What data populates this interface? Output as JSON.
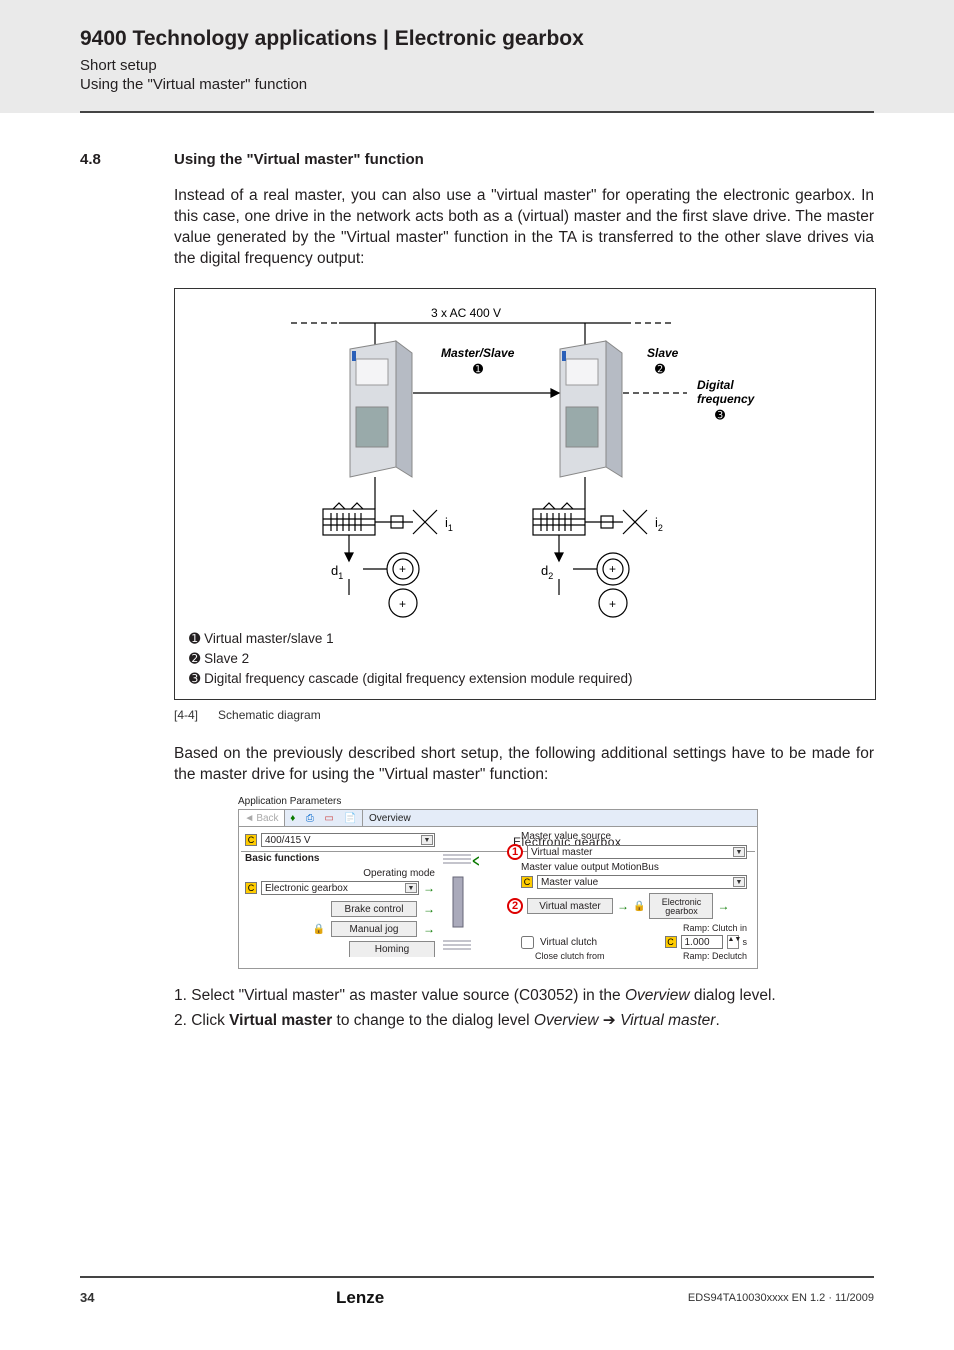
{
  "header": {
    "title": "9400 Technology applications | Electronic gearbox",
    "sub1": "Short setup",
    "sub2": "Using the \"Virtual master\" function"
  },
  "section": {
    "num": "4.8",
    "title": "Using the \"Virtual master\" function",
    "para1": "Instead of a real master, you can also use a \"virtual master\" for operating the electronic gearbox. In this case, one drive in the network acts both as a (virtual) master and the first slave drive. The master value generated by the \"Virtual master\" function in the TA is transferred to the other slave drives via the digital frequency output:"
  },
  "figure": {
    "supply": "3 x AC 400 V",
    "ms_label": "Master/Slave",
    "slave_label": "Slave",
    "df_label1": "Digital",
    "df_label2": "frequency",
    "i1": "i",
    "i1s": "1",
    "i2": "i",
    "i2s": "2",
    "d1": "d",
    "d1s": "1",
    "d2": "d",
    "d2s": "2",
    "legend1": " Virtual master/slave 1",
    "legend2": " Slave 2",
    "legend3": " Digital frequency cascade (digital frequency extension module required)"
  },
  "caption": {
    "num": "[4-4]",
    "text": "Schematic diagram"
  },
  "para2": "Based on the previously described short setup, the following additional settings have to be made for the master drive for using the \"Virtual master\" function:",
  "shot": {
    "app_params": "Application Parameters",
    "back": "Back",
    "overview": "Overview",
    "voltage": "400/415 V",
    "eg_title": "Electronic gearbox",
    "basic": "Basic functions",
    "opmode_lbl": "Operating mode",
    "opmode_val": "Electronic gearbox",
    "brake": "Brake control",
    "manjog": "Manual jog",
    "homing": "Homing",
    "mvs": "Master value source",
    "vm": "Virtual master",
    "mvomb": "Master value output MotionBus",
    "mv": "Master value",
    "vmbtn": "Virtual master",
    "egbtn1": "Electronic",
    "egbtn2": "gearbox",
    "rci": "Ramp: Clutch in",
    "vclutch": "Virtual clutch",
    "rcval": "1.000",
    "rcunit": "s",
    "ccf": "Close clutch from",
    "rdc": "Ramp: Declutch"
  },
  "steps": {
    "s1a": "1. Select \"Virtual master\" as master value source (C03052) in the ",
    "s1b": "Overview",
    "s1c": " dialog level.",
    "s2a": "2. Click ",
    "s2b": "Virtual master",
    "s2c": " to change to the dialog level ",
    "s2d": "Overview",
    "s2e": " ➔ ",
    "s2f": "Virtual master",
    "s2g": "."
  },
  "footer": {
    "page": "34",
    "docid": "EDS94TA10030xxxx EN 1.2 · 11/2009"
  }
}
